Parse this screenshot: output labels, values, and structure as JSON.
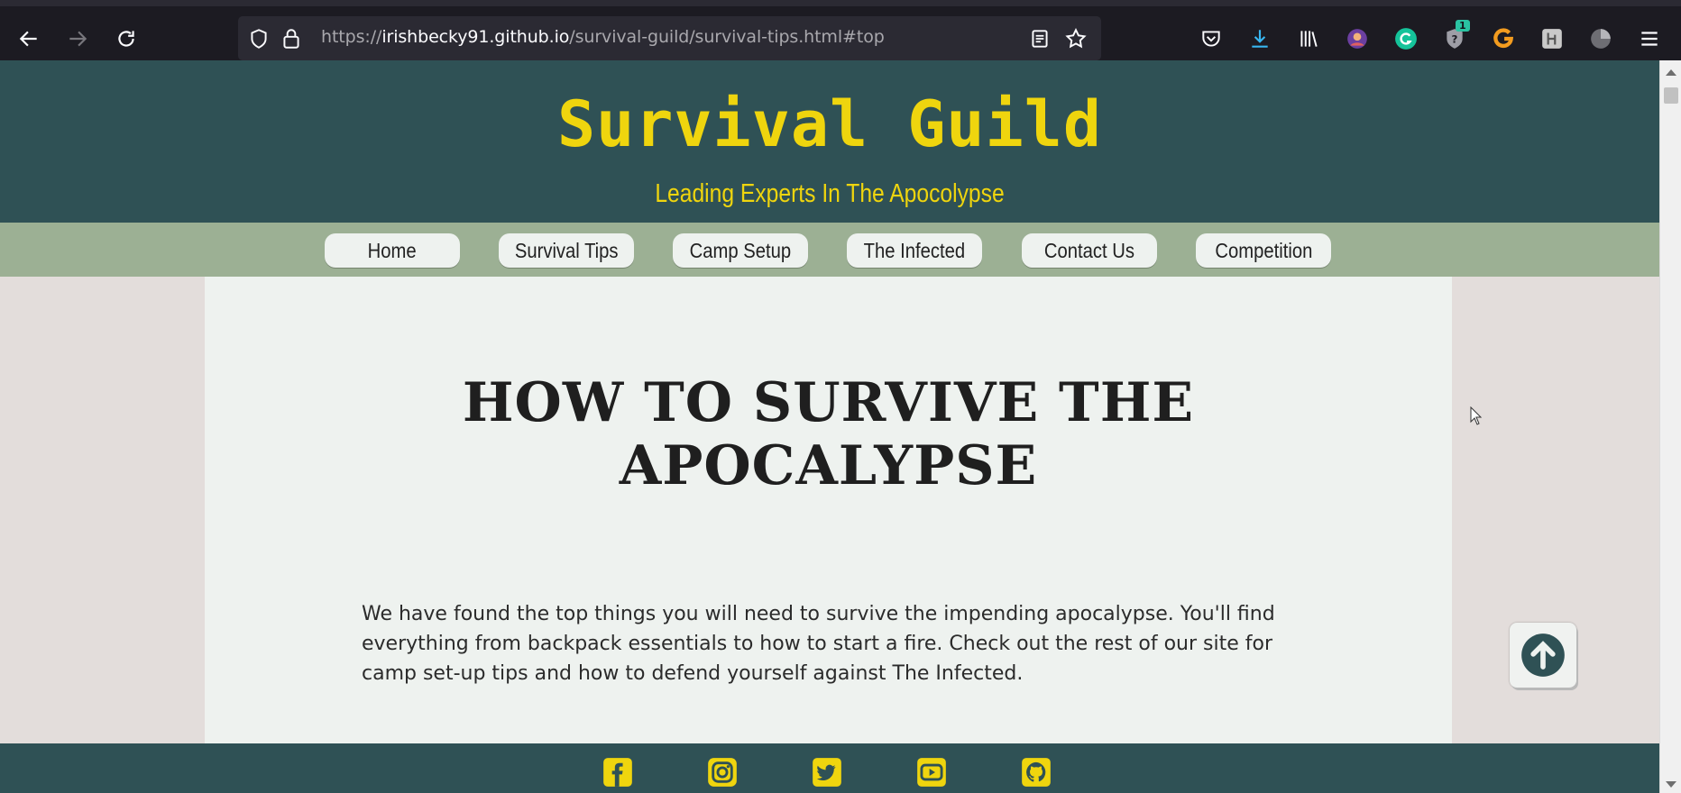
{
  "browser": {
    "url_scheme": "https://",
    "url_host": "irishbecky91.github.io",
    "url_path": "/survival-guild/survival-tips.html#top",
    "extension_badge": "1"
  },
  "header": {
    "title": "Survival Guild",
    "tagline": "Leading Experts In The Apocolypse"
  },
  "nav": {
    "items": [
      {
        "label": "Home"
      },
      {
        "label": "Survival Tips"
      },
      {
        "label": "Camp Setup"
      },
      {
        "label": "The Infected"
      },
      {
        "label": "Contact Us"
      },
      {
        "label": "Competition"
      }
    ]
  },
  "main": {
    "heading_line1": "HOW TO SURVIVE THE",
    "heading_line2": "APOCALYPSE",
    "intro": "We have found the top things you will need to survive the impending apocalypse. You'll find everything from backpack essentials to how to start a fire. Check out the rest of our site for camp set-up tips and how to defend yourself against The Infected."
  },
  "footer": {
    "social_icons": [
      "facebook-icon",
      "instagram-icon",
      "twitter-icon",
      "youtube-icon",
      "github-icon"
    ]
  },
  "colors": {
    "header_bg": "#2f5155",
    "accent_yellow": "#efd50e",
    "nav_bg": "#9cb094",
    "content_bg": "#eef2ef",
    "page_bg": "#e3dddb"
  }
}
